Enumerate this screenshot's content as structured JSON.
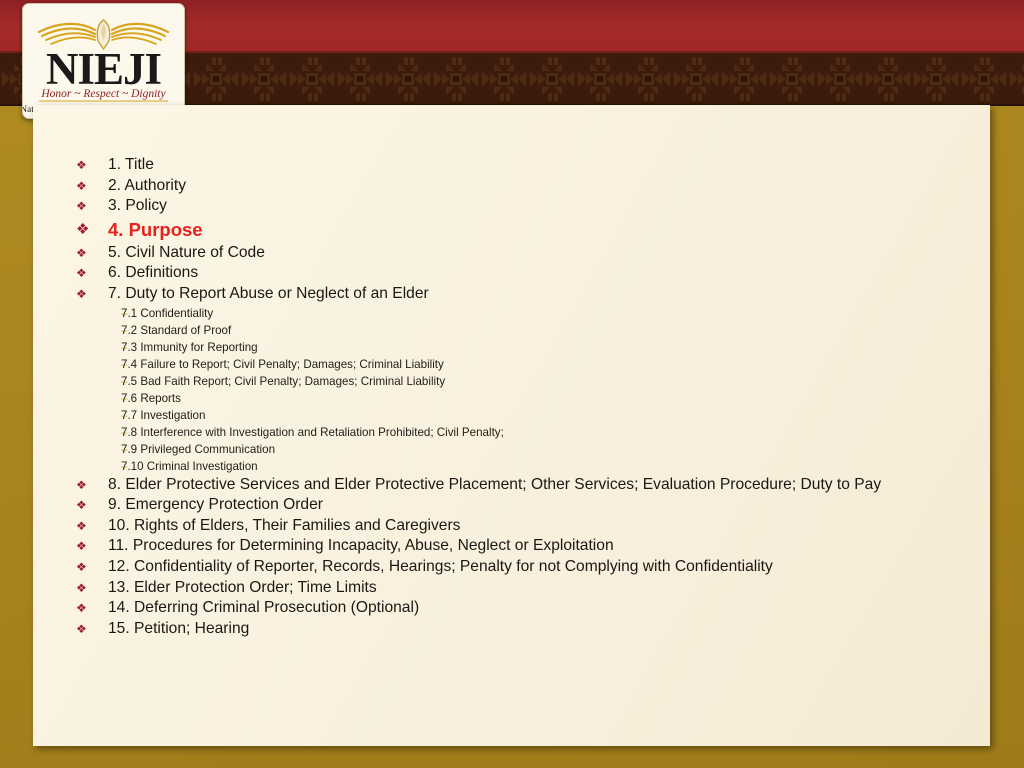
{
  "theme": {
    "frame_color": "#a8841d",
    "band_red": "#a02826",
    "band_brown": "#3b1b0c",
    "panel_bg": "#faf2e0",
    "bullet_color": "#9d1c2e",
    "subbullet_color": "#d8b33c",
    "accent_text_color": "#e5231d",
    "body_text_color": "#1c1713"
  },
  "logo": {
    "name": "nieji-logo",
    "wordmark": "NIEJI",
    "tagline": "Honor  ~  Respect  ~  Dignity",
    "org_name": "National Indigenous Elder Justice Initiative",
    "emblem": "eagle-icon"
  },
  "bullets": {
    "level1_glyph": "❖",
    "level2_glyph": "–"
  },
  "outline": {
    "items": [
      {
        "label": "1. Title",
        "level": 1,
        "accent": false
      },
      {
        "label": "2. Authority",
        "level": 1,
        "accent": false
      },
      {
        "label": "3. Policy",
        "level": 1,
        "accent": false
      },
      {
        "label": "4. Purpose",
        "level": 1,
        "accent": true
      },
      {
        "label": "5. Civil Nature of Code",
        "level": 1,
        "accent": false
      },
      {
        "label": "6. Definitions",
        "level": 1,
        "accent": false
      },
      {
        "label": "7. Duty to Report Abuse or Neglect of an Elder",
        "level": 1,
        "accent": false
      },
      {
        "label": "7.1 Confidentiality",
        "level": 2,
        "accent": false
      },
      {
        "label": "7.2 Standard of Proof",
        "level": 2,
        "accent": false
      },
      {
        "label": "7.3 Immunity for Reporting",
        "level": 2,
        "accent": false
      },
      {
        "label": "7.4 Failure to Report; Civil Penalty; Damages; Criminal Liability",
        "level": 2,
        "accent": false
      },
      {
        "label": "7.5 Bad Faith Report; Civil Penalty; Damages; Criminal Liability",
        "level": 2,
        "accent": false
      },
      {
        "label": "7.6 Reports",
        "level": 2,
        "accent": false
      },
      {
        "label": "7.7 Investigation",
        "level": 2,
        "accent": false
      },
      {
        "label": "7.8 Interference with Investigation and Retaliation Prohibited; Civil Penalty;",
        "level": 2,
        "accent": false
      },
      {
        "label": "7.9 Privileged Communication",
        "level": 2,
        "accent": false
      },
      {
        "label": "7.10 Criminal Investigation",
        "level": 2,
        "accent": false
      },
      {
        "label": "8. Elder Protective Services and Elder Protective Placement; Other Services; Evaluation Procedure; Duty to Pay",
        "level": 1,
        "accent": false
      },
      {
        "label": "9. Emergency Protection Order",
        "level": 1,
        "accent": false
      },
      {
        "label": "10. Rights of Elders, Their Families and Caregivers",
        "level": 1,
        "accent": false
      },
      {
        "label": "11. Procedures for Determining Incapacity, Abuse, Neglect or Exploitation",
        "level": 1,
        "accent": false
      },
      {
        "label": "12. Confidentiality of Reporter, Records, Hearings; Penalty for not Complying with Confidentiality",
        "level": 1,
        "accent": false
      },
      {
        "label": "13. Elder Protection Order; Time Limits",
        "level": 1,
        "accent": false
      },
      {
        "label": "14. Deferring Criminal Prosecution (Optional)",
        "level": 1,
        "accent": false
      },
      {
        "label": "15. Petition; Hearing",
        "level": 1,
        "accent": false
      }
    ]
  }
}
